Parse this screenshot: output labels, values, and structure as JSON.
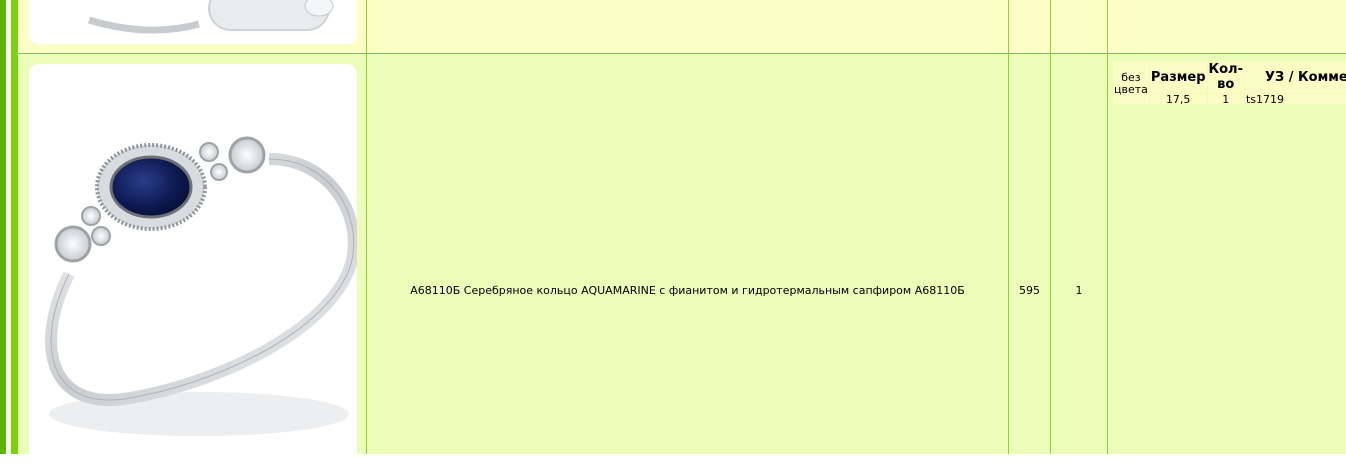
{
  "product": {
    "description": "А68110Б Серебряное кольцо AQUAMARINE с фианитом и гидротермальным сапфиром А68110Б",
    "price": "595",
    "quantity": "1",
    "image_icon": "silver-ring-sapphire-icon"
  },
  "options": {
    "color_label": "без цвета",
    "headers": {
      "size": "Размер",
      "qty": "Кол-во",
      "comment": "УЗ / Коммент"
    },
    "row": {
      "size": "17,5",
      "qty": "1",
      "comment": "ts1719"
    }
  },
  "colors": {
    "row_main": "#ecfcb9",
    "row_top": "#fdfdc6",
    "accent_green": "#7cd10d",
    "sapphire": "#0d1a52"
  }
}
